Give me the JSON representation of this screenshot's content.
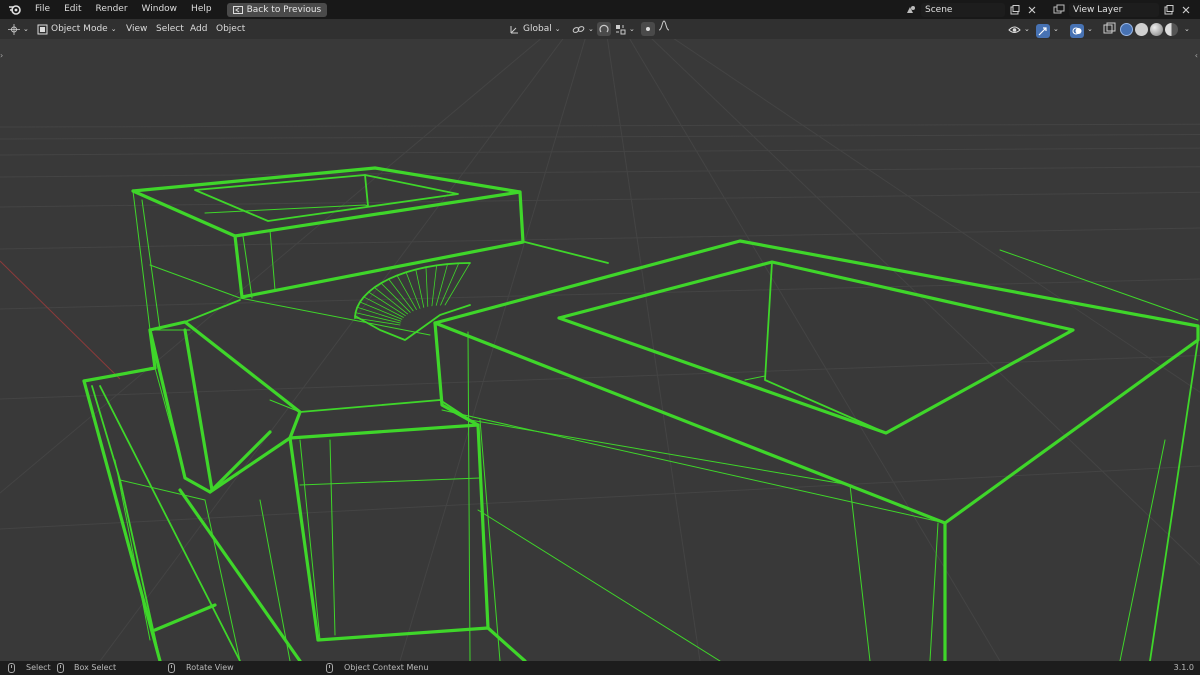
{
  "topbar": {
    "menu": [
      "File",
      "Edit",
      "Render",
      "Window",
      "Help"
    ],
    "back_button": "Back to Previous",
    "scene_value": "Scene",
    "view_layer_value": "View Layer"
  },
  "header": {
    "mode": "Object Mode",
    "menus": [
      "View",
      "Select",
      "Add",
      "Object"
    ],
    "orientation": "Global"
  },
  "statusbar": {
    "select": "Select",
    "box_select": "Box Select",
    "rotate_view": "Rotate View",
    "context_menu": "Object Context Menu",
    "version": "3.1.0"
  },
  "colors": {
    "wire": "#3fd62a",
    "viewport_bg": "#393939",
    "grid": "#444444",
    "x_axis": "#8a3a3a"
  }
}
